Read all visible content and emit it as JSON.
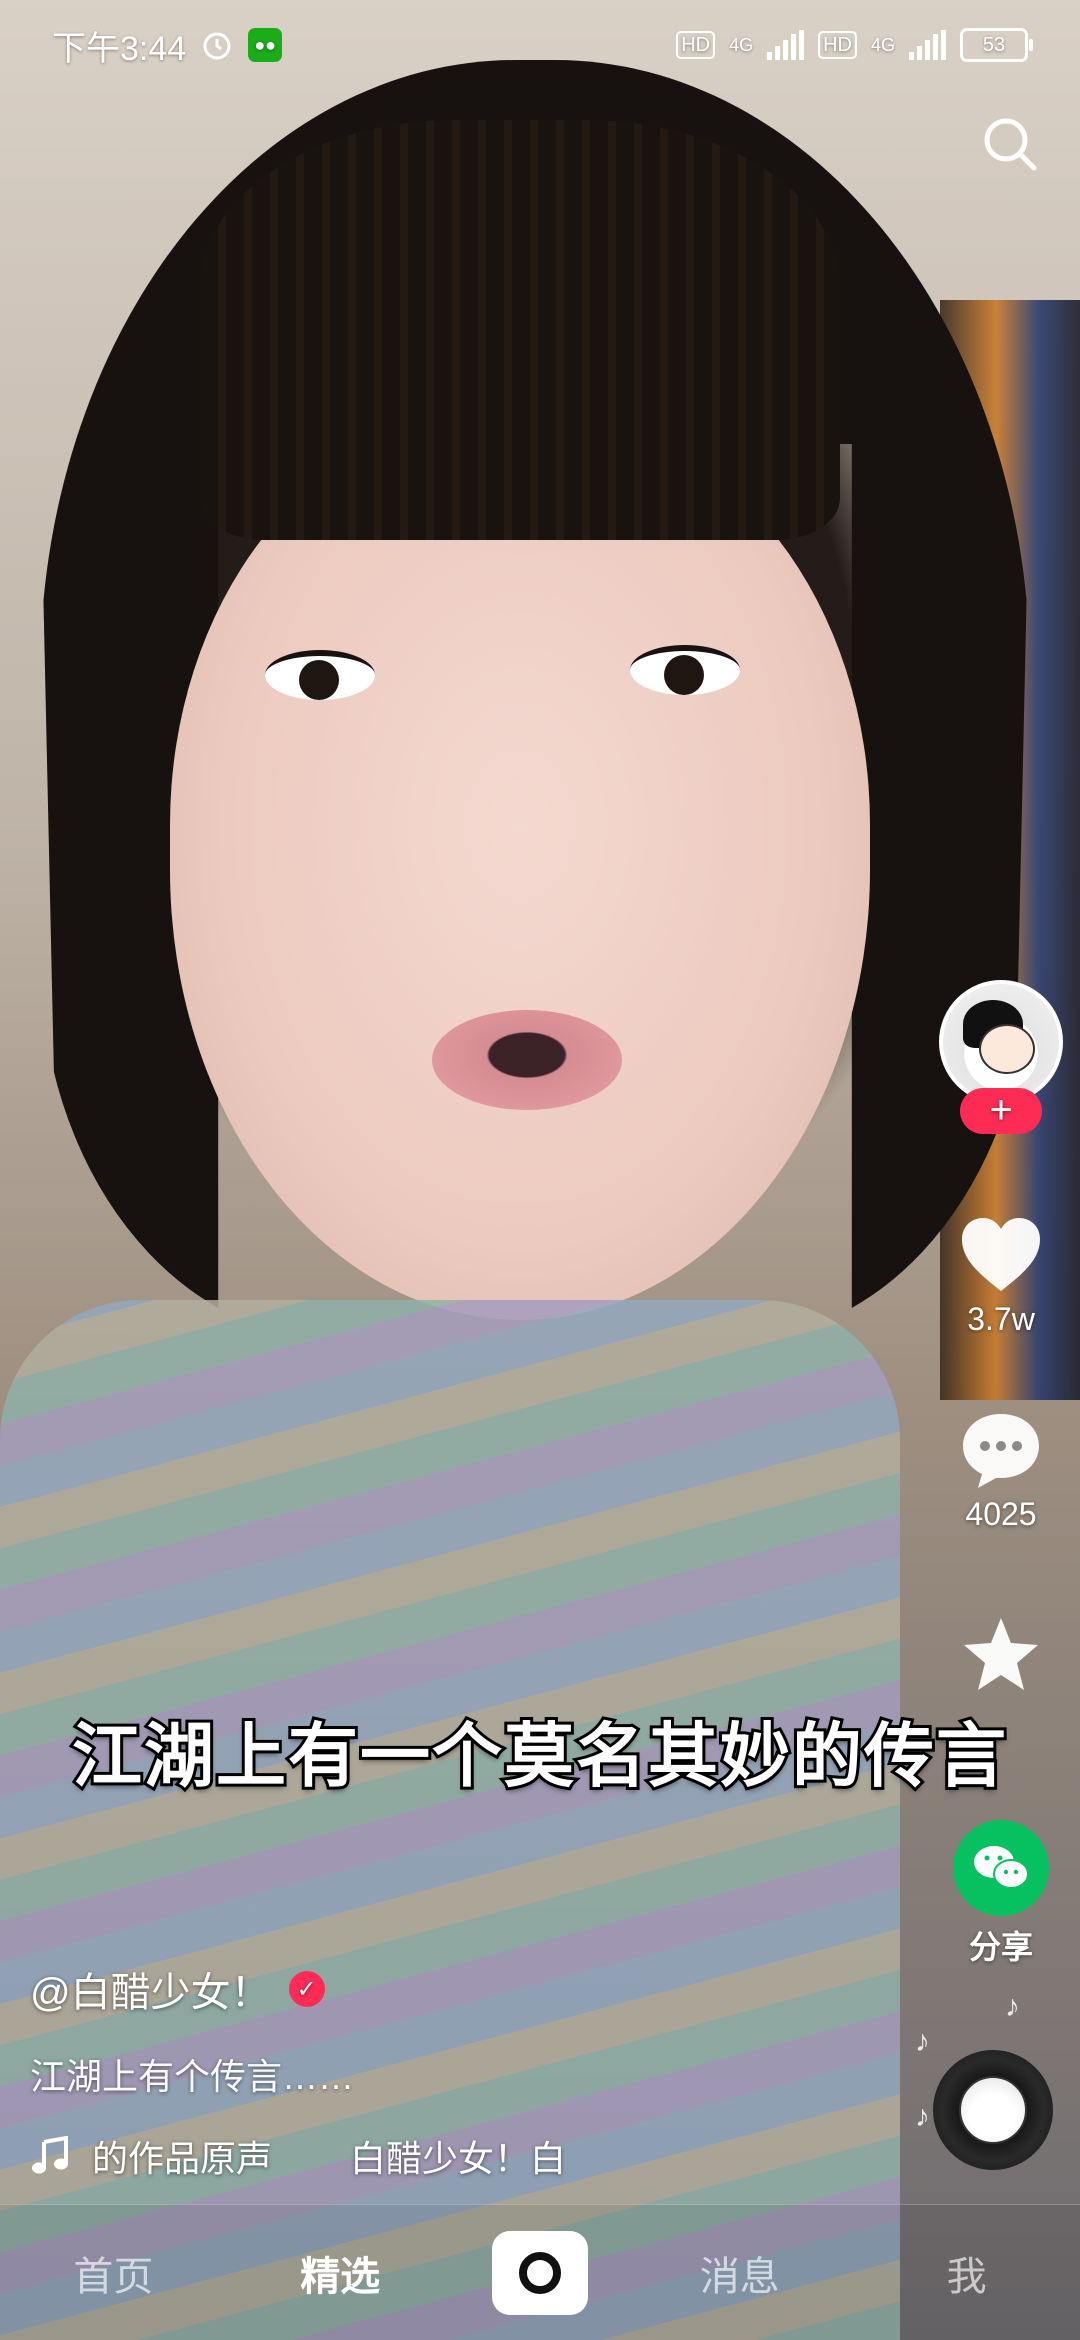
{
  "status_bar": {
    "time": "下午3:44",
    "hd_label_1": "HD",
    "net_label_1": "4G",
    "hd_label_2": "HD",
    "net_label_2": "4G",
    "battery": "53"
  },
  "icons": {
    "search": "search-icon",
    "alarm": "alarm-icon",
    "wechat": "wechat-icon",
    "like": "heart-icon",
    "comment": "comment-icon",
    "favorite": "star-icon",
    "share": "wechat-share-icon",
    "music": "music-note-icon",
    "verified": "check-icon"
  },
  "colors": {
    "accent": "#fe2c55",
    "share_green": "#07c160"
  },
  "rail": {
    "follow_symbol": "+",
    "likes": "3.7w",
    "comments": "4025",
    "share_label": "分享"
  },
  "subtitle": "江湖上有一个莫名其妙的传言",
  "info": {
    "author": "@白醋少女！",
    "description": "江湖上有个传言……",
    "music_title": "的作品原声",
    "music_author": "白醋少女！白"
  },
  "nav": {
    "home": "首页",
    "featured": "精选",
    "messages": "消息",
    "me": "我"
  }
}
